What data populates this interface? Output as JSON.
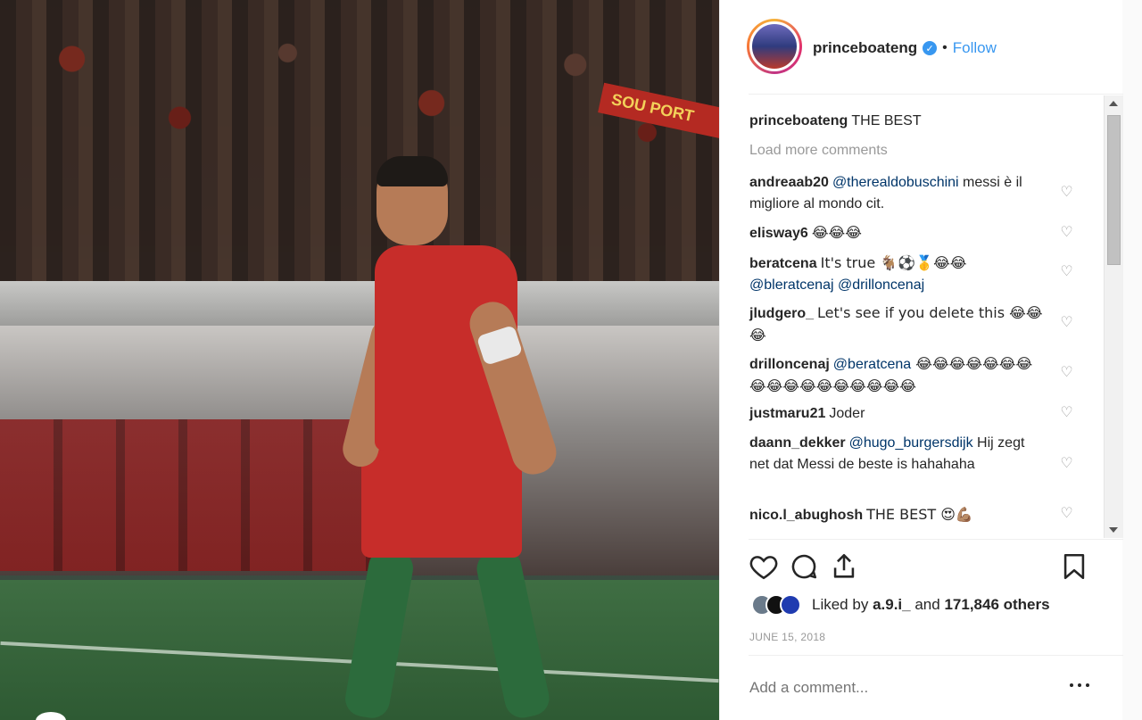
{
  "post": {
    "username": "princeboateng",
    "follow_label": "Follow",
    "dot": "•",
    "caption_user": "princeboateng",
    "caption_text": "THE BEST",
    "load_more": "Load more comments",
    "banner_text": "SOU PORT"
  },
  "comments": [
    {
      "user": "andreaab20",
      "mention": "@therealdobuschini",
      "text": " messi è il migliore al mondo cit."
    },
    {
      "user": "elisway6",
      "mention": "",
      "text": "😂😂😂"
    },
    {
      "user": "beratcena",
      "mention": "",
      "text": "It's true 🐐⚽🥇😂😂",
      "mention2": "@bleratcenaj @drilloncenaj"
    },
    {
      "user": "jludgero_",
      "mention": "",
      "text": "Let's see if you delete this 😂😂😂"
    },
    {
      "user": "drilloncenaj",
      "mention": "@beratcena",
      "text": " 😂😂😂😂😂😂😂😂😂😂😂😂😂😂😂😂😂"
    },
    {
      "user": "justmaru21",
      "mention": "",
      "text": "Joder"
    },
    {
      "user": "daann_dekker",
      "mention": "@hugo_burgersdijk",
      "text": " Hij zegt net dat Messi de beste is hahahaha"
    },
    {
      "user": "nico.l_abughosh",
      "mention": "",
      "text": "THE BEST 😍💪🏽"
    }
  ],
  "likes": {
    "prefix": "Liked by",
    "user": "a.9.i_",
    "middle": "and",
    "count": "171,846 others"
  },
  "date": "JUNE 15, 2018",
  "comment_input": {
    "placeholder": "Add a comment..."
  },
  "icons": {
    "like": "heart-icon",
    "comment": "comment-icon",
    "share": "share-icon",
    "save": "bookmark-icon",
    "verified": "verified-icon",
    "more": "more-options-icon"
  },
  "colors": {
    "accent": "#3897f0",
    "text": "#262626",
    "muted": "#999999",
    "mention": "#003569"
  }
}
